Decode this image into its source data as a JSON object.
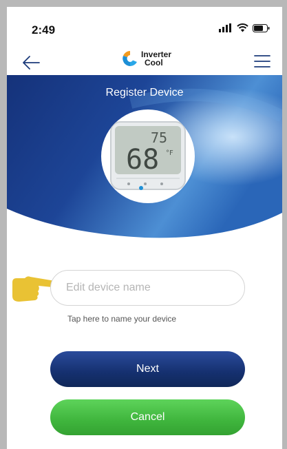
{
  "status_bar": {
    "time": "2:49",
    "icons": [
      "signal-icon",
      "wifi-icon",
      "battery-icon"
    ]
  },
  "nav": {
    "back_icon": "arrow-left-icon",
    "logo": {
      "line1": "Inverter",
      "line2": "Cool"
    },
    "menu_icon": "hamburger-menu-icon"
  },
  "hero": {
    "title": "Register Device",
    "device_display": {
      "setpoint": "75",
      "temperature": "68",
      "unit": "°F"
    }
  },
  "form": {
    "device_name": {
      "value": "",
      "placeholder": "Edit device name",
      "hint": "Tap here to name your device"
    }
  },
  "actions": {
    "next_label": "Next",
    "cancel_label": "Cancel"
  },
  "colors": {
    "hero_blue": "#1d3c8a",
    "next_button": "#1a3a80",
    "cancel_button": "#45b843",
    "pointer_hand": "#e9c234"
  }
}
